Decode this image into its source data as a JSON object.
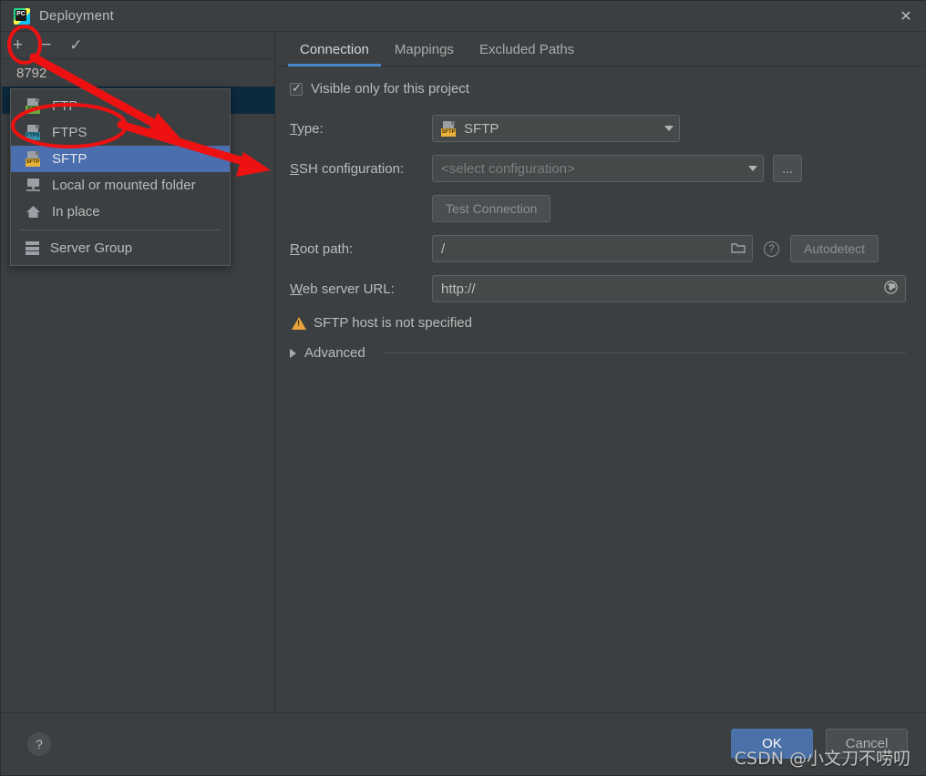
{
  "window": {
    "title": "Deployment",
    "app_icon": "pycharm-logo-icon",
    "close_label": "✕"
  },
  "toolbar": {
    "add_label": "+",
    "remove_label": "−",
    "check_label": "✓"
  },
  "server_list": {
    "items": [
      {
        "label": "8792",
        "selected": false
      },
      {
        "label": "",
        "selected": true
      }
    ]
  },
  "add_menu": {
    "items": [
      {
        "label": "FTP",
        "icon": "ftp-file-icon",
        "badge": "FTP",
        "badge_class": "ftp",
        "selected": false
      },
      {
        "label": "FTPS",
        "icon": "ftps-file-icon",
        "badge": "FTPS",
        "badge_class": "ftps",
        "selected": false
      },
      {
        "label": "SFTP",
        "icon": "sftp-file-icon",
        "badge": "SFTP",
        "badge_class": "sftp",
        "selected": true
      },
      {
        "label": "Local or mounted folder",
        "icon": "network-folder-icon",
        "badge": "",
        "badge_class": "",
        "selected": false
      },
      {
        "label": "In place",
        "icon": "home-icon",
        "badge": "",
        "badge_class": "",
        "selected": false
      },
      {
        "label": "Server Group",
        "icon": "server-group-icon",
        "badge": "",
        "badge_class": "",
        "selected": false,
        "separator_before": true
      }
    ]
  },
  "tabs": [
    {
      "label": "Connection",
      "active": true
    },
    {
      "label": "Mappings",
      "active": false
    },
    {
      "label": "Excluded Paths",
      "active": false
    }
  ],
  "form": {
    "visible_only_checkbox": {
      "label": "Visible only for this project",
      "checked": true
    },
    "type": {
      "label": "Type:",
      "mnemonic": "T",
      "value": "SFTP",
      "icon_badge": "SFTP"
    },
    "ssh_configuration": {
      "label": "SSH configuration:",
      "mnemonic": "S",
      "placeholder": "<select configuration>",
      "value": "",
      "browse_label": "..."
    },
    "test_connection": {
      "label": "Test Connection",
      "enabled": false
    },
    "root_path": {
      "label": "Root path:",
      "mnemonic": "R",
      "value": "/",
      "folder_icon": "folder-icon",
      "help_icon": "question-mark-icon",
      "autodetect_label": "Autodetect"
    },
    "web_server_url": {
      "label": "Web server URL:",
      "mnemonic": "W",
      "value": "http://",
      "globe_icon": "globe-icon"
    },
    "warning": {
      "icon": "warning-triangle-icon",
      "text": "SFTP host is not specified"
    },
    "advanced": {
      "label": "Advanced",
      "expanded": false
    }
  },
  "footer": {
    "help_label": "?",
    "ok_label": "OK",
    "cancel_label": "Cancel"
  },
  "watermark": {
    "text": "CSDN @小文刀不唠叨"
  },
  "colors": {
    "dialog_background": "#3c3f41",
    "selection_blue": "#4b6eaf",
    "tab_underline": "#4a88c7",
    "ok_button": "#4a71a8",
    "row_selected_dark": "#0d293e",
    "annotation_red": "#ee1111",
    "warning_amber": "#e8a33d"
  }
}
